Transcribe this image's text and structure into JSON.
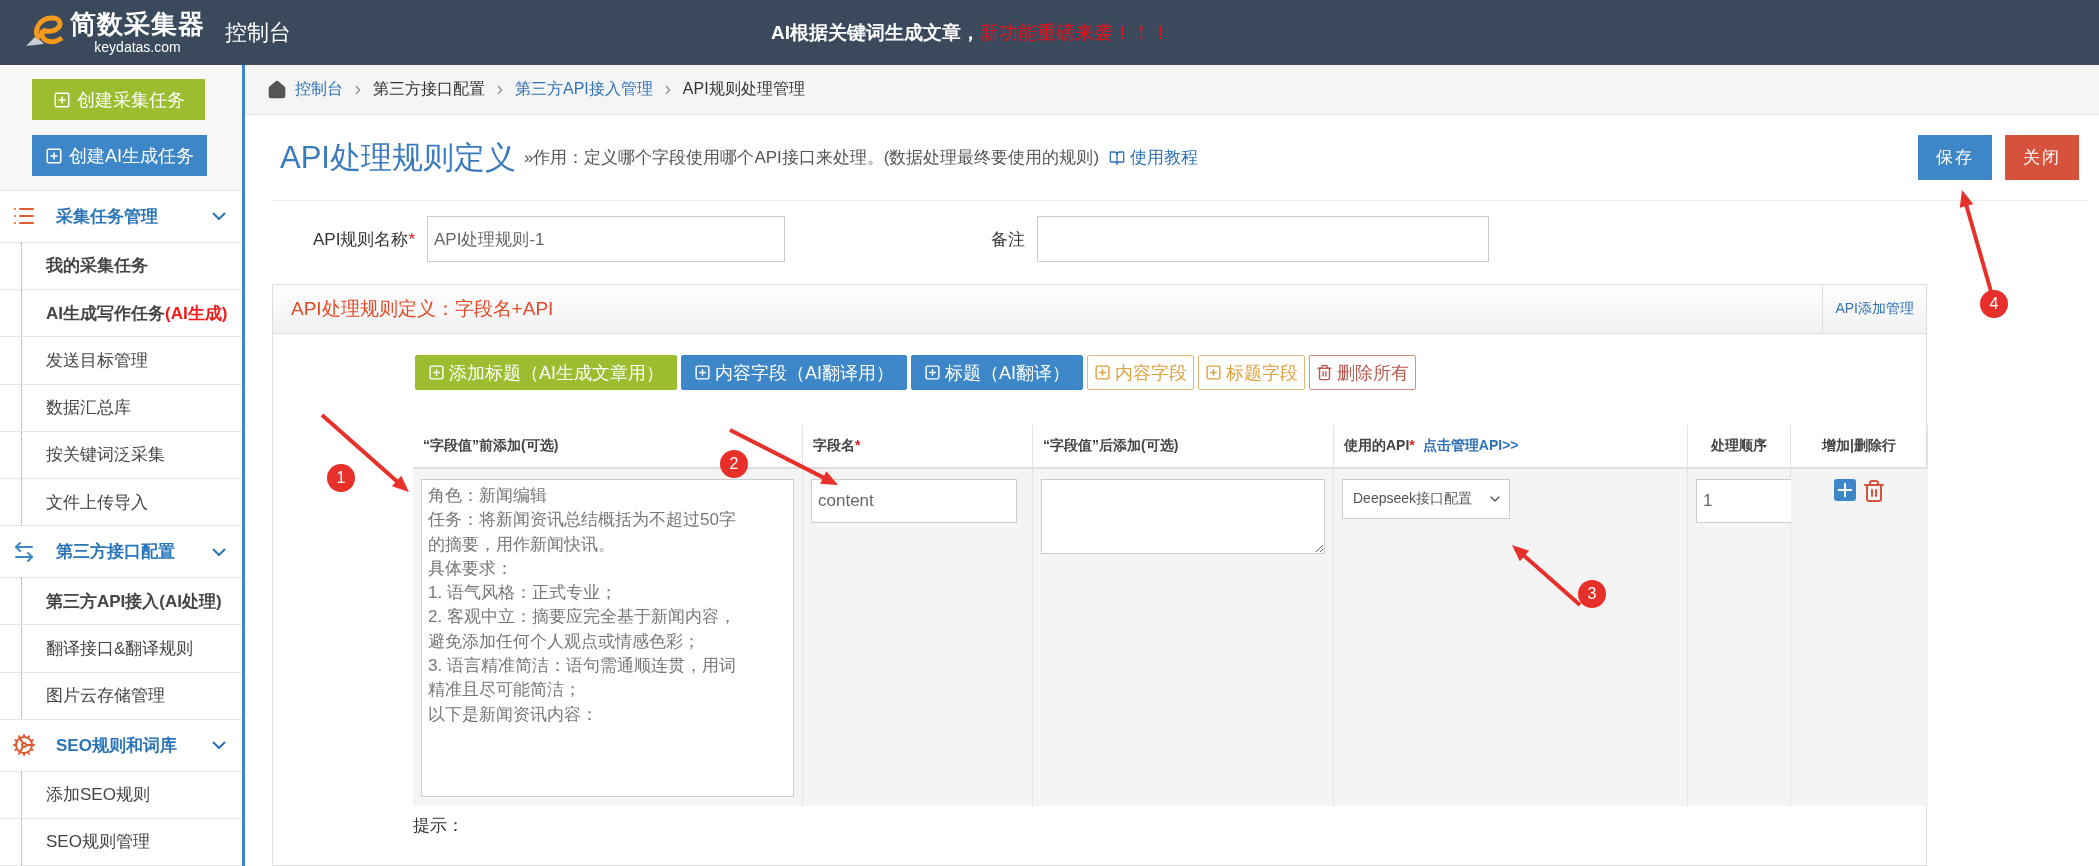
{
  "header": {
    "logo_title": "简数采集器",
    "logo_domain": "keydatas.com",
    "console": "控制台",
    "announcement": "AI根据关键词生成文章，",
    "announcement_highlight": "新功能重磅来袭！！！"
  },
  "sidebar": {
    "buttons": [
      {
        "label": "创建采集任务",
        "kind": "green"
      },
      {
        "label": "创建AI生成任务",
        "kind": "blue"
      }
    ],
    "sections": [
      {
        "title": "采集任务管理",
        "items": [
          {
            "label": "我的采集任务",
            "emphasized": true
          },
          {
            "label": "AI生成写作任务",
            "badge": "(AI生成)",
            "emphasized": true
          },
          {
            "label": "发送目标管理",
            "emphasized": false
          },
          {
            "label": "数据汇总库",
            "emphasized": false
          },
          {
            "label": "按关键词泛采集",
            "emphasized": false
          },
          {
            "label": "文件上传导入",
            "emphasized": false
          }
        ]
      },
      {
        "title": "第三方接口配置",
        "items": [
          {
            "label": "第三方API接入(AI处理)",
            "emphasized": true
          },
          {
            "label": "翻译接口&翻译规则",
            "emphasized": false
          },
          {
            "label": "图片云存储管理",
            "emphasized": false
          }
        ]
      },
      {
        "title": "SEO规则和词库",
        "items": [
          {
            "label": "添加SEO规则",
            "emphasized": false
          },
          {
            "label": "SEO规则管理",
            "emphasized": false
          }
        ]
      }
    ]
  },
  "breadcrumb": [
    {
      "label": "控制台",
      "link": true
    },
    {
      "label": "第三方接口配置",
      "link": false
    },
    {
      "label": "第三方API接入管理",
      "link": true
    },
    {
      "label": "API规则处理管理",
      "link": false
    }
  ],
  "page": {
    "title": "API处理规则定义",
    "subtitle": "»作用：定义哪个字段使用哪个API接口来处理。(数据处理最终要使用的规则)",
    "help_link": "使用教程",
    "actions": [
      {
        "label": "保存",
        "kind": "primary"
      },
      {
        "label": "关闭",
        "kind": "danger"
      }
    ]
  },
  "form": [
    {
      "label": "API规则名称",
      "required_mark": "*",
      "value": "API处理规则-1"
    },
    {
      "label": "备注"
    }
  ],
  "panel": {
    "title": "API处理规则定义：字段名+API",
    "link": "API添加管理",
    "toolbar": [
      {
        "label": "添加标题（AI生成文章用）",
        "kind": "green"
      },
      {
        "label": "内容字段（AI翻译用）",
        "kind": "blue"
      },
      {
        "label": "标题（AI翻译）",
        "kind": "blue"
      },
      {
        "label": "内容字段",
        "kind": "outline-orange"
      },
      {
        "label": "标题字段",
        "kind": "outline-orange"
      },
      {
        "label": "删除所有",
        "kind": "outline-red"
      }
    ],
    "columns": [
      {
        "label": "“字段值”前添加(可选)"
      },
      {
        "label": "字段名",
        "required_mark": "*"
      },
      {
        "label": "“字段值”后添加(可选)"
      },
      {
        "label": "使用的API",
        "required_mark": "*",
        "link": "点击管理API>>"
      },
      {
        "label": "处理顺序"
      },
      {
        "label": "增加|删除行"
      }
    ],
    "rows": [
      {
        "prefix_lines": [
          "角色：新闻编辑",
          "任务：将新闻资讯总结概括为不超过50字",
          "的摘要，用作新闻快讯。",
          "具体要求：",
          "1. 语气风格：正式专业；",
          "2. 客观中立：摘要应完全基于新闻内容，",
          "避免添加任何个人观点或情感色彩；",
          "3. 语言精准简洁：语句需通顺连贯，用词",
          "精准且尽可能简洁；",
          "以下是新闻资讯内容："
        ],
        "field": "content",
        "api": "Deepseek接口配置",
        "order": "1"
      }
    ],
    "hint": "提示："
  },
  "annotations": [
    {
      "label": "1"
    },
    {
      "label": "2"
    },
    {
      "label": "3"
    },
    {
      "label": "4"
    }
  ]
}
